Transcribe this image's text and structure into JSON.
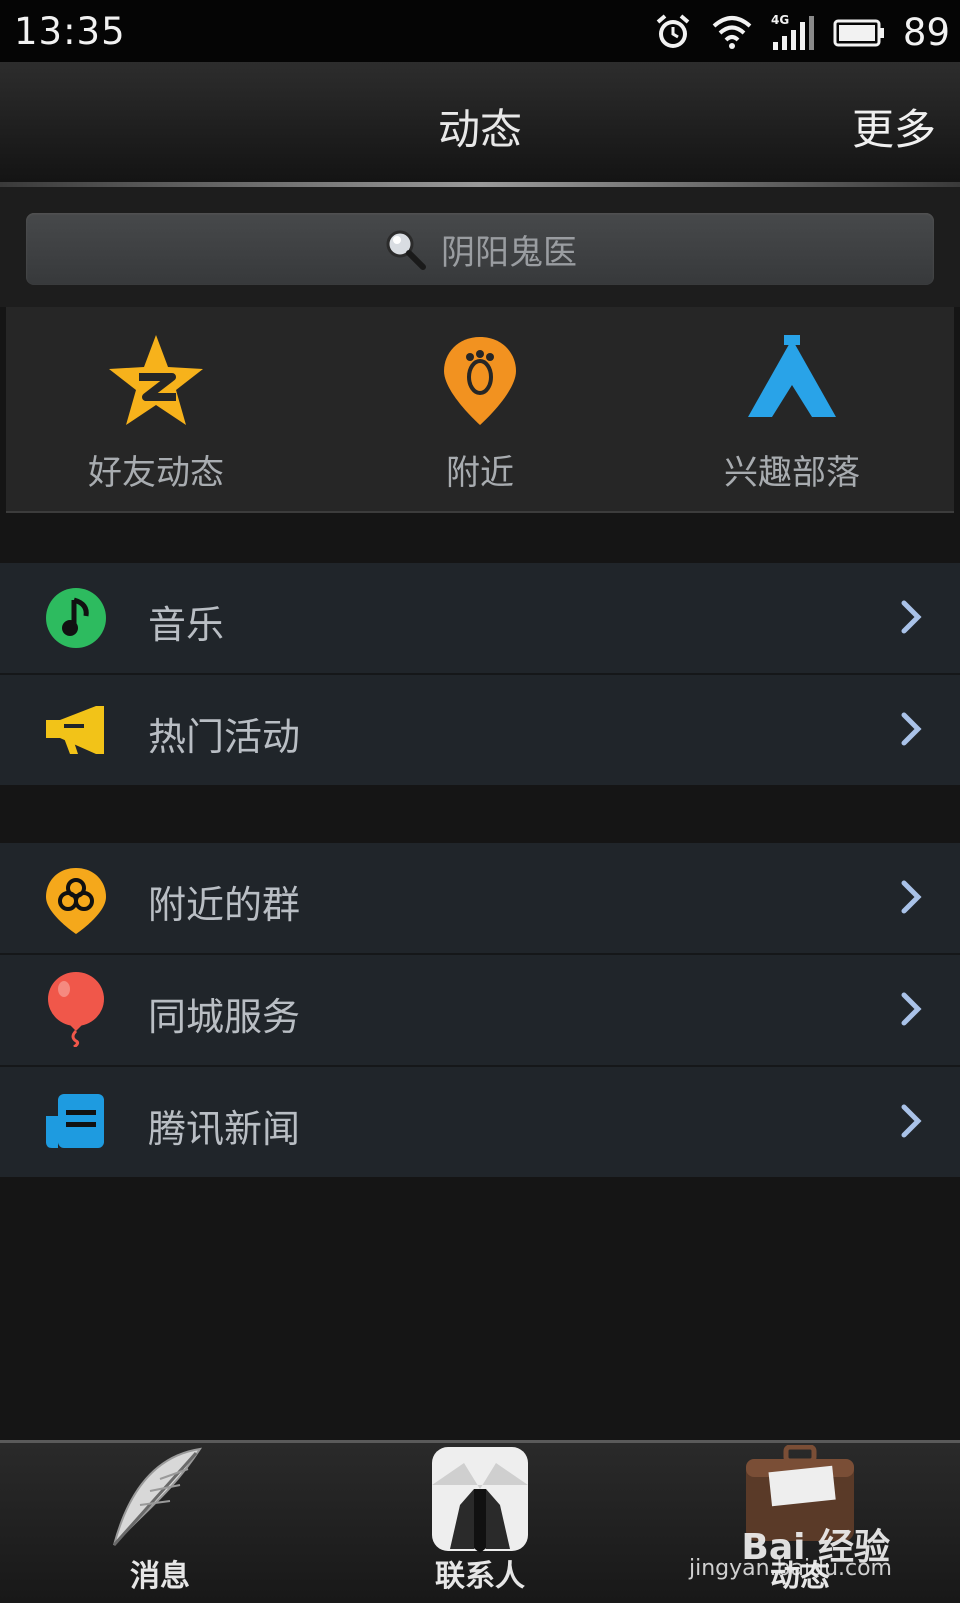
{
  "status_bar": {
    "time": "13:35",
    "battery": "89",
    "network": "4G"
  },
  "header": {
    "title": "动态",
    "more": "更多"
  },
  "search": {
    "placeholder": "阴阳鬼医"
  },
  "quick_entries": [
    {
      "label": "好友动态",
      "icon": "qzone-star-icon"
    },
    {
      "label": "附近",
      "icon": "nearby-footprint-icon"
    },
    {
      "label": "兴趣部落",
      "icon": "tribe-tent-icon"
    }
  ],
  "group1": [
    {
      "label": "音乐",
      "icon": "music-note-icon"
    },
    {
      "label": "热门活动",
      "icon": "megaphone-icon"
    }
  ],
  "group2": [
    {
      "label": "附近的群",
      "icon": "nearby-group-icon"
    },
    {
      "label": "同城服务",
      "icon": "balloon-icon"
    },
    {
      "label": "腾讯新闻",
      "icon": "news-icon"
    }
  ],
  "tabs": [
    {
      "label": "消息",
      "icon": "feather-icon"
    },
    {
      "label": "联系人",
      "icon": "shirt-collar-icon"
    },
    {
      "label": "动态",
      "icon": "briefcase-icon"
    }
  ],
  "watermark": {
    "brand": "Bai 经验",
    "url": "jingyan.baidu.com"
  },
  "colors": {
    "header_bg": "#1b1b1b",
    "list_bg": "#20252a",
    "chevron": "#a9c2e8"
  }
}
